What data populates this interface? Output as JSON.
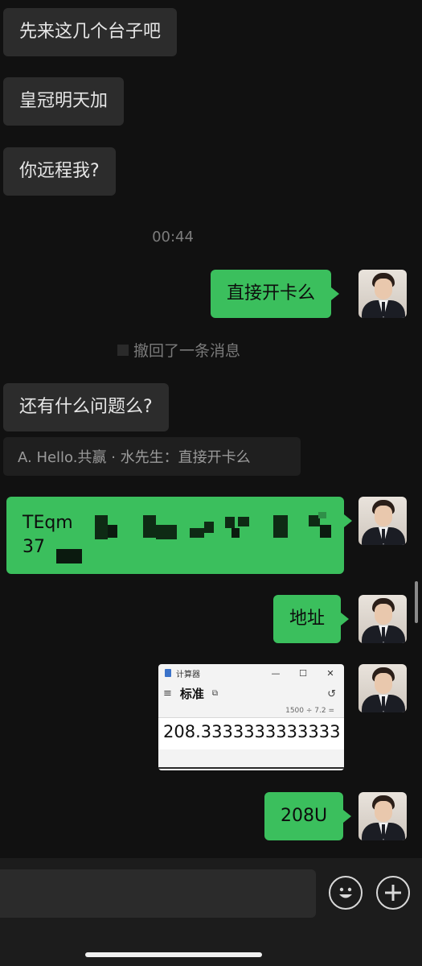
{
  "messages": {
    "m1": "先来这几个台子吧",
    "m2": "皇冠明天加",
    "m3": "你远程我?",
    "time": "00:44",
    "m4": "直接开卡么",
    "recall": "撤回了一条消息",
    "m5": "还有什么问题么?",
    "quote": "A. Hello.共赢 · 水先生：直接开卡么",
    "address_line1": "TEqm",
    "address_line2": "37",
    "m7": "地址",
    "m8": "208U"
  },
  "calculator": {
    "window_title": "计算器",
    "mode": "标准",
    "expression": "1500 ÷ 7.2 =",
    "result": "208.3333333333333",
    "minimize": "—",
    "maximize": "☐",
    "close": "✕",
    "menu_icon": "≡",
    "pin_icon": "⧉",
    "history_icon": "↺"
  },
  "input": {
    "emoji_icon": "emoji-icon",
    "plus_icon": "plus-icon"
  },
  "colors": {
    "outgoing_bubble": "#3bbf5d",
    "incoming_bubble": "#2c2c2c",
    "background": "#111111"
  }
}
